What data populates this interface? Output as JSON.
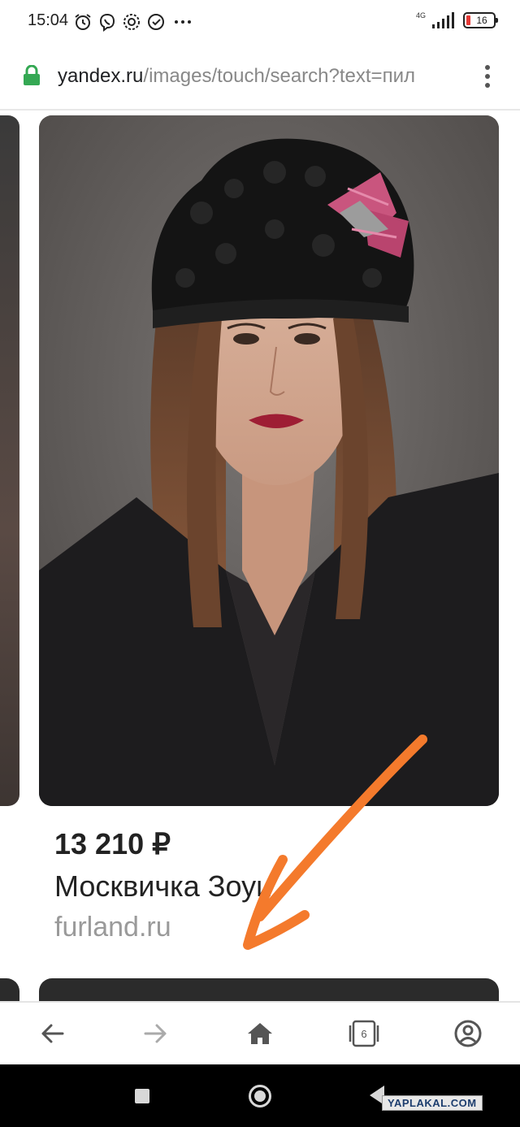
{
  "status_bar": {
    "time": "15:04",
    "network": "4G",
    "battery": "16",
    "icons": [
      "alarm-icon",
      "viber-icon",
      "settings-icon",
      "check-icon",
      "more-icon"
    ]
  },
  "address_bar": {
    "domain": "yandex.ru",
    "path": "/images/touch/search?text=пил",
    "lock_color": "#34a853"
  },
  "result": {
    "price": "13 210 ₽",
    "title": "Москвичка Зоуи",
    "source": "furland.ru"
  },
  "toolbar": {
    "tab_count": "6",
    "icons": [
      "back-arrow-icon",
      "forward-arrow-icon",
      "home-icon",
      "tabs-icon",
      "account-icon"
    ]
  },
  "watermark": "YAPLAKAL.COM",
  "colors": {
    "annotation": "#f47a2c",
    "text": "#222222",
    "source_text": "#9a9a9a"
  }
}
